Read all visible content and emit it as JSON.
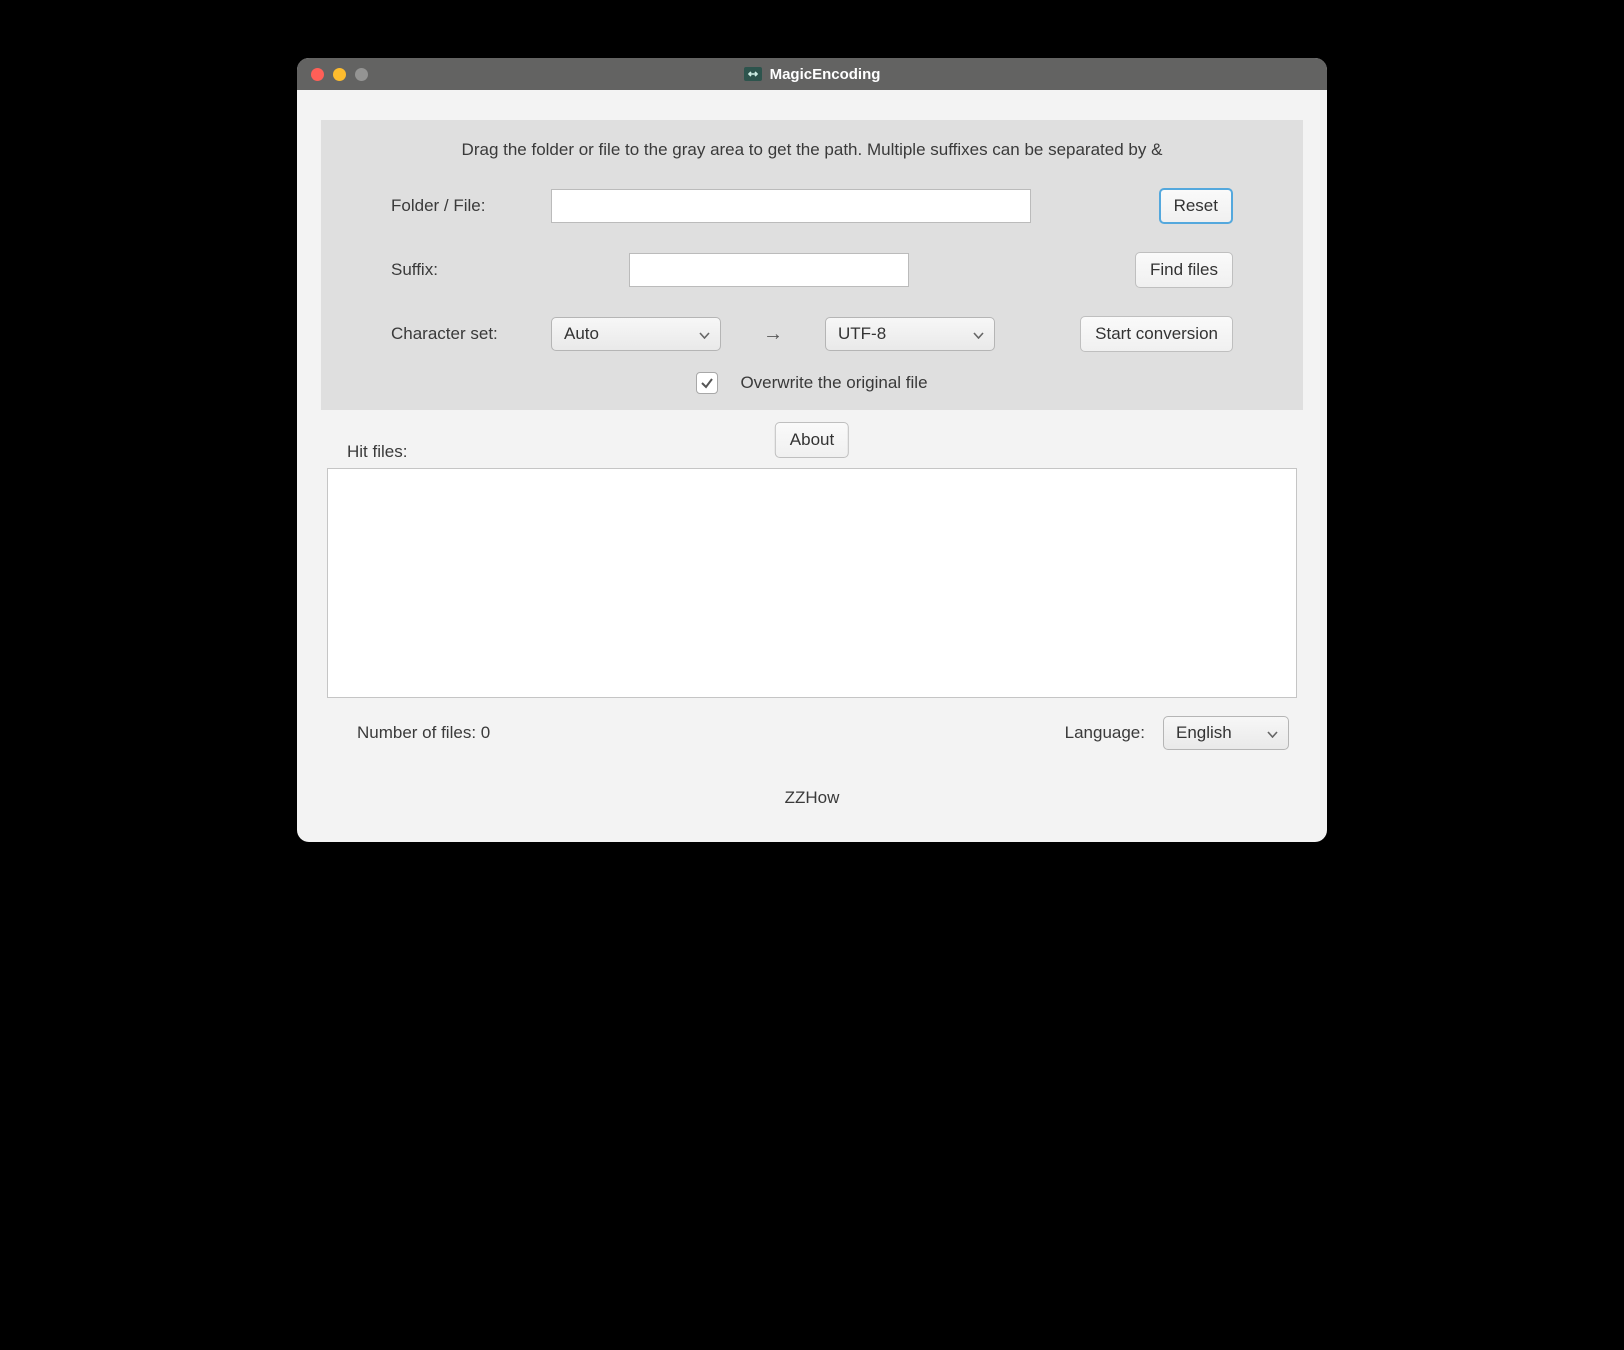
{
  "window": {
    "title": "MagicEncoding"
  },
  "panel": {
    "instruction": "Drag the folder or file to the gray area to get the path. Multiple suffixes can be separated by &",
    "folder_label": "Folder / File:",
    "folder_value": "",
    "reset_label": "Reset",
    "suffix_label": "Suffix:",
    "suffix_value": "",
    "find_files_label": "Find files",
    "charset_label": "Character set:",
    "source_charset": "Auto",
    "arrow": "→",
    "target_charset": "UTF-8",
    "start_label": "Start conversion",
    "overwrite_checked": true,
    "overwrite_label": "Overwrite the original file"
  },
  "main": {
    "about_label": "About",
    "hit_files_label": "Hit files:",
    "count_label": "Number of files: 0",
    "language_label": "Language:",
    "language_value": "English"
  },
  "footer": {
    "author": "ZZHow"
  }
}
